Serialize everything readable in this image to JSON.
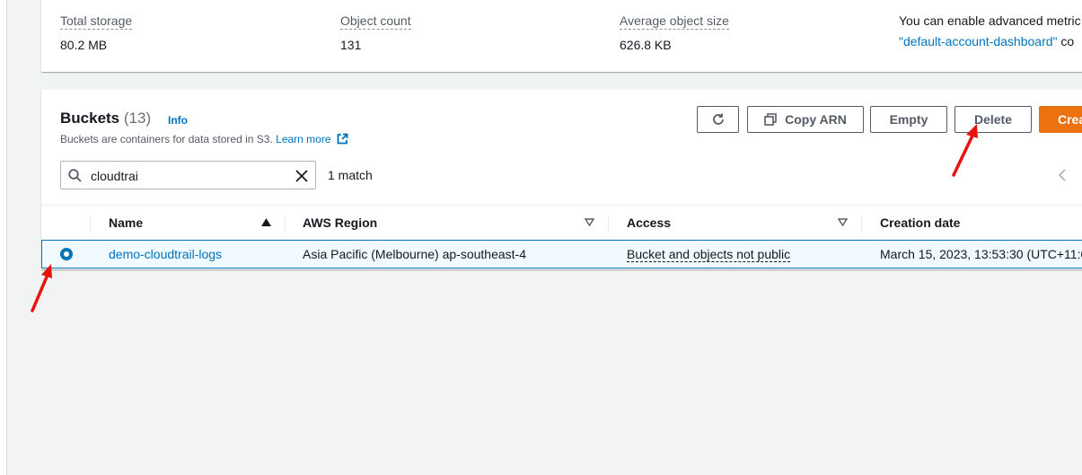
{
  "metrics": {
    "total_storage_label": "Total storage",
    "total_storage_value": "80.2 MB",
    "object_count_label": "Object count",
    "object_count_value": "131",
    "avg_size_label": "Average object size",
    "avg_size_value": "626.8 KB",
    "note_line1": "You can enable advanced metric",
    "note_link": "\"default-account-dashboard\"",
    "note_line2_rest": "co"
  },
  "buckets": {
    "title": "Buckets",
    "count": "(13)",
    "info_label": "Info",
    "description": "Buckets are containers for data stored in S3.",
    "learn_more": "Learn more",
    "buttons": {
      "copy_arn": "Copy ARN",
      "empty": "Empty",
      "delete": "Delete",
      "create": "Crea"
    },
    "search_value": "cloudtrai",
    "match_text": "1 match",
    "columns": {
      "name": "Name",
      "region": "AWS Region",
      "access": "Access",
      "creation": "Creation date"
    },
    "rows": [
      {
        "name": "demo-cloudtrail-logs",
        "region": "Asia Pacific (Melbourne) ap-southeast-4",
        "access": "Bucket and objects not public",
        "creation": "March 15, 2023, 13:53:30 (UTC+11:0"
      }
    ]
  },
  "colors": {
    "accent": "#0073bb",
    "primary_button": "#ec7211",
    "annotation_arrow": "#e8140c"
  }
}
